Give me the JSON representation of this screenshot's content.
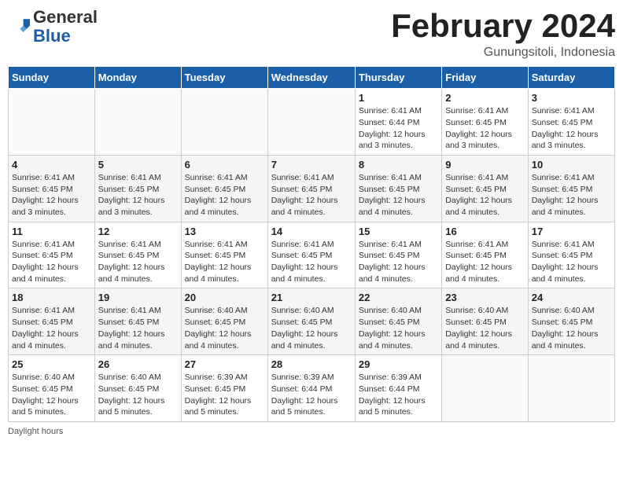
{
  "header": {
    "logo_general": "General",
    "logo_blue": "Blue",
    "month_title": "February 2024",
    "location": "Gunungsitoli, Indonesia"
  },
  "calendar": {
    "weekdays": [
      "Sunday",
      "Monday",
      "Tuesday",
      "Wednesday",
      "Thursday",
      "Friday",
      "Saturday"
    ],
    "weeks": [
      [
        {
          "day": "",
          "info": ""
        },
        {
          "day": "",
          "info": ""
        },
        {
          "day": "",
          "info": ""
        },
        {
          "day": "",
          "info": ""
        },
        {
          "day": "1",
          "info": "Sunrise: 6:41 AM\nSunset: 6:44 PM\nDaylight: 12 hours\nand 3 minutes."
        },
        {
          "day": "2",
          "info": "Sunrise: 6:41 AM\nSunset: 6:45 PM\nDaylight: 12 hours\nand 3 minutes."
        },
        {
          "day": "3",
          "info": "Sunrise: 6:41 AM\nSunset: 6:45 PM\nDaylight: 12 hours\nand 3 minutes."
        }
      ],
      [
        {
          "day": "4",
          "info": "Sunrise: 6:41 AM\nSunset: 6:45 PM\nDaylight: 12 hours\nand 3 minutes."
        },
        {
          "day": "5",
          "info": "Sunrise: 6:41 AM\nSunset: 6:45 PM\nDaylight: 12 hours\nand 3 minutes."
        },
        {
          "day": "6",
          "info": "Sunrise: 6:41 AM\nSunset: 6:45 PM\nDaylight: 12 hours\nand 4 minutes."
        },
        {
          "day": "7",
          "info": "Sunrise: 6:41 AM\nSunset: 6:45 PM\nDaylight: 12 hours\nand 4 minutes."
        },
        {
          "day": "8",
          "info": "Sunrise: 6:41 AM\nSunset: 6:45 PM\nDaylight: 12 hours\nand 4 minutes."
        },
        {
          "day": "9",
          "info": "Sunrise: 6:41 AM\nSunset: 6:45 PM\nDaylight: 12 hours\nand 4 minutes."
        },
        {
          "day": "10",
          "info": "Sunrise: 6:41 AM\nSunset: 6:45 PM\nDaylight: 12 hours\nand 4 minutes."
        }
      ],
      [
        {
          "day": "11",
          "info": "Sunrise: 6:41 AM\nSunset: 6:45 PM\nDaylight: 12 hours\nand 4 minutes."
        },
        {
          "day": "12",
          "info": "Sunrise: 6:41 AM\nSunset: 6:45 PM\nDaylight: 12 hours\nand 4 minutes."
        },
        {
          "day": "13",
          "info": "Sunrise: 6:41 AM\nSunset: 6:45 PM\nDaylight: 12 hours\nand 4 minutes."
        },
        {
          "day": "14",
          "info": "Sunrise: 6:41 AM\nSunset: 6:45 PM\nDaylight: 12 hours\nand 4 minutes."
        },
        {
          "day": "15",
          "info": "Sunrise: 6:41 AM\nSunset: 6:45 PM\nDaylight: 12 hours\nand 4 minutes."
        },
        {
          "day": "16",
          "info": "Sunrise: 6:41 AM\nSunset: 6:45 PM\nDaylight: 12 hours\nand 4 minutes."
        },
        {
          "day": "17",
          "info": "Sunrise: 6:41 AM\nSunset: 6:45 PM\nDaylight: 12 hours\nand 4 minutes."
        }
      ],
      [
        {
          "day": "18",
          "info": "Sunrise: 6:41 AM\nSunset: 6:45 PM\nDaylight: 12 hours\nand 4 minutes."
        },
        {
          "day": "19",
          "info": "Sunrise: 6:41 AM\nSunset: 6:45 PM\nDaylight: 12 hours\nand 4 minutes."
        },
        {
          "day": "20",
          "info": "Sunrise: 6:40 AM\nSunset: 6:45 PM\nDaylight: 12 hours\nand 4 minutes."
        },
        {
          "day": "21",
          "info": "Sunrise: 6:40 AM\nSunset: 6:45 PM\nDaylight: 12 hours\nand 4 minutes."
        },
        {
          "day": "22",
          "info": "Sunrise: 6:40 AM\nSunset: 6:45 PM\nDaylight: 12 hours\nand 4 minutes."
        },
        {
          "day": "23",
          "info": "Sunrise: 6:40 AM\nSunset: 6:45 PM\nDaylight: 12 hours\nand 4 minutes."
        },
        {
          "day": "24",
          "info": "Sunrise: 6:40 AM\nSunset: 6:45 PM\nDaylight: 12 hours\nand 4 minutes."
        }
      ],
      [
        {
          "day": "25",
          "info": "Sunrise: 6:40 AM\nSunset: 6:45 PM\nDaylight: 12 hours\nand 5 minutes."
        },
        {
          "day": "26",
          "info": "Sunrise: 6:40 AM\nSunset: 6:45 PM\nDaylight: 12 hours\nand 5 minutes."
        },
        {
          "day": "27",
          "info": "Sunrise: 6:39 AM\nSunset: 6:45 PM\nDaylight: 12 hours\nand 5 minutes."
        },
        {
          "day": "28",
          "info": "Sunrise: 6:39 AM\nSunset: 6:44 PM\nDaylight: 12 hours\nand 5 minutes."
        },
        {
          "day": "29",
          "info": "Sunrise: 6:39 AM\nSunset: 6:44 PM\nDaylight: 12 hours\nand 5 minutes."
        },
        {
          "day": "",
          "info": ""
        },
        {
          "day": "",
          "info": ""
        }
      ]
    ]
  },
  "footer": {
    "note": "Daylight hours"
  }
}
